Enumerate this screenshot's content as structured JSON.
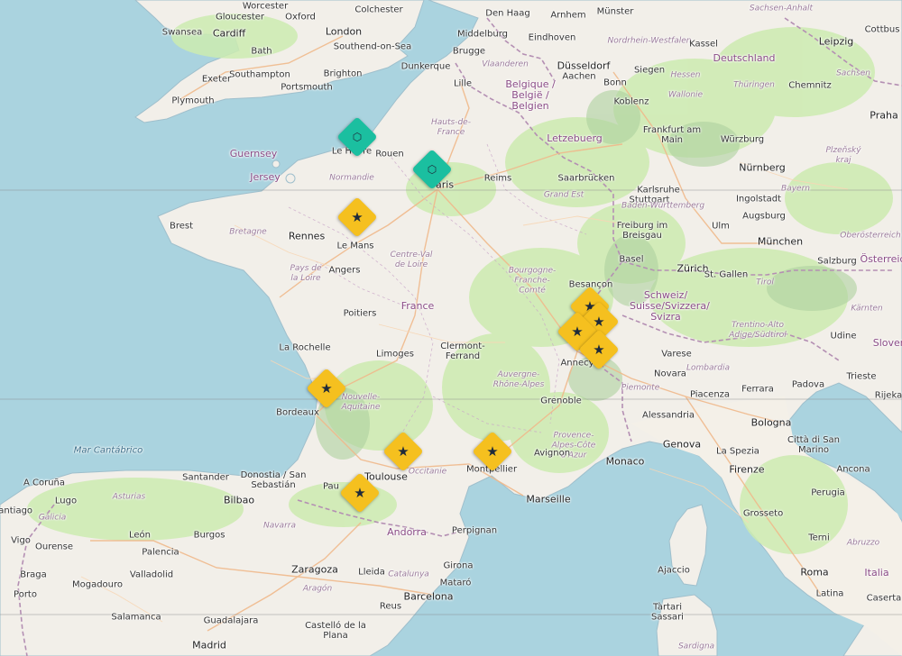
{
  "map": {
    "colors": {
      "water": "#aad3df",
      "land": "#f2efe9",
      "park": "#cdebb0",
      "forest": "#add19e",
      "border": "#b48fb3",
      "road": "#f0b98b",
      "star_marker": "#f5c01f",
      "site_marker": "#1bbfa0",
      "glyph": "#1e2a3a"
    },
    "labels": [
      {
        "text": "Worcester",
        "kind": "city"
      },
      {
        "text": "Colchester",
        "kind": "city"
      },
      {
        "text": "Den Haag",
        "kind": "city"
      },
      {
        "text": "Arnhem",
        "kind": "city"
      },
      {
        "text": "Münster",
        "kind": "city"
      },
      {
        "text": "Sachsen-Anhalt",
        "kind": "region"
      },
      {
        "text": "Gloucester",
        "kind": "city"
      },
      {
        "text": "Oxford",
        "kind": "city"
      },
      {
        "text": "Cottbus",
        "kind": "city"
      },
      {
        "text": "Swansea",
        "kind": "city"
      },
      {
        "text": "Cardiff",
        "kind": "capital"
      },
      {
        "text": "London",
        "kind": "capital"
      },
      {
        "text": "Middelburg",
        "kind": "city"
      },
      {
        "text": "Eindhoven",
        "kind": "city"
      },
      {
        "text": "Nordrhein-Westfalen",
        "kind": "region"
      },
      {
        "text": "Kassel",
        "kind": "city"
      },
      {
        "text": "Leipzig",
        "kind": "city"
      },
      {
        "text": "Bath",
        "kind": "city"
      },
      {
        "text": "Southend-on-Sea",
        "kind": "city"
      },
      {
        "text": "Brugge",
        "kind": "city"
      },
      {
        "text": "Vlaanderen",
        "kind": "region"
      },
      {
        "text": "Düsseldorf",
        "kind": "city"
      },
      {
        "text": "Hessen",
        "kind": "region"
      },
      {
        "text": "Deutschland",
        "kind": "country"
      },
      {
        "text": "Southampton",
        "kind": "city"
      },
      {
        "text": "Brighton",
        "kind": "city"
      },
      {
        "text": "Dunkerque",
        "kind": "city"
      },
      {
        "text": "Aachen",
        "kind": "city"
      },
      {
        "text": "Bonn",
        "kind": "city"
      },
      {
        "text": "Siegen",
        "kind": "city"
      },
      {
        "text": "Thüringen",
        "kind": "region"
      },
      {
        "text": "Exeter",
        "kind": "city"
      },
      {
        "text": "Portsmouth",
        "kind": "city"
      },
      {
        "text": "Lille",
        "kind": "city"
      },
      {
        "text": "Sachsen",
        "kind": "region"
      },
      {
        "text": "Belgique / België / Belgien",
        "kind": "country"
      },
      {
        "text": "Wallonie",
        "kind": "region"
      },
      {
        "text": "Koblenz",
        "kind": "city"
      },
      {
        "text": "Chemnitz",
        "kind": "city"
      },
      {
        "text": "Plymouth",
        "kind": "city"
      },
      {
        "text": "Hauts-de-France",
        "kind": "region"
      },
      {
        "text": "Letzebuerg",
        "kind": "country"
      },
      {
        "text": "Frankfurt am Main",
        "kind": "city"
      },
      {
        "text": "Würzburg",
        "kind": "city"
      },
      {
        "text": "Praha",
        "kind": "city"
      },
      {
        "text": "Guernsey",
        "kind": "country"
      },
      {
        "text": "Le Havre",
        "kind": "city"
      },
      {
        "text": "Rouen",
        "kind": "city"
      },
      {
        "text": "Saarbrücken",
        "kind": "city"
      },
      {
        "text": "Plzeňský kraj",
        "kind": "region"
      },
      {
        "text": "Jersey",
        "kind": "country"
      },
      {
        "text": "Normandie",
        "kind": "region"
      },
      {
        "text": "Reims",
        "kind": "city"
      },
      {
        "text": "Nürnberg",
        "kind": "city"
      },
      {
        "text": "Grand Est",
        "kind": "region"
      },
      {
        "text": "Karlsruhe",
        "kind": "city"
      },
      {
        "text": "Paris",
        "kind": "capital"
      },
      {
        "text": "Bayern",
        "kind": "region"
      },
      {
        "text": "Ingolstadt",
        "kind": "city"
      },
      {
        "text": "Stuttgart",
        "kind": "city"
      },
      {
        "text": "Baden-Württemberg",
        "kind": "region"
      },
      {
        "text": "Brest",
        "kind": "city"
      },
      {
        "text": "Augsburg",
        "kind": "city"
      },
      {
        "text": "Bretagne",
        "kind": "region"
      },
      {
        "text": "Rennes",
        "kind": "city"
      },
      {
        "text": "Le Mans",
        "kind": "city"
      },
      {
        "text": "Ulm",
        "kind": "city"
      },
      {
        "text": "Freiburg im Breisgau",
        "kind": "city"
      },
      {
        "text": "München",
        "kind": "city"
      },
      {
        "text": "Oberösterreich",
        "kind": "region"
      },
      {
        "text": "Centre-Val de Loire",
        "kind": "region"
      },
      {
        "text": "Angers",
        "kind": "city"
      },
      {
        "text": "Basel",
        "kind": "city"
      },
      {
        "text": "Zürich",
        "kind": "city"
      },
      {
        "text": "Salzburg",
        "kind": "city"
      },
      {
        "text": "Österreich",
        "kind": "country"
      },
      {
        "text": "Pays de la Loire",
        "kind": "region"
      },
      {
        "text": "Bourgogne-Franche-Comté",
        "kind": "region"
      },
      {
        "text": "St. Gallen",
        "kind": "city"
      },
      {
        "text": "Tirol",
        "kind": "region"
      },
      {
        "text": "Besançon",
        "kind": "city"
      },
      {
        "text": "France",
        "kind": "country"
      },
      {
        "text": "Schweiz/ Suisse/Svizzera/ Svizra",
        "kind": "country"
      },
      {
        "text": "Poitiers",
        "kind": "city"
      },
      {
        "text": "Kärnten",
        "kind": "region"
      },
      {
        "text": "Trentino-Alto Adige/Südtirol",
        "kind": "region"
      },
      {
        "text": "La Rochelle",
        "kind": "city"
      },
      {
        "text": "Clermont-Ferrand",
        "kind": "city"
      },
      {
        "text": "Udine",
        "kind": "city"
      },
      {
        "text": "Limoges",
        "kind": "city"
      },
      {
        "text": "Slover",
        "kind": "country"
      },
      {
        "text": "Varese",
        "kind": "city"
      },
      {
        "text": "Annecy",
        "kind": "city"
      },
      {
        "text": "Novara",
        "kind": "city"
      },
      {
        "text": "Lombardia",
        "kind": "region"
      },
      {
        "text": "Padova",
        "kind": "city"
      },
      {
        "text": "Trieste",
        "kind": "city"
      },
      {
        "text": "Auvergne-Rhône-Alpes",
        "kind": "region"
      },
      {
        "text": "Nouvelle-Aquitaine",
        "kind": "region"
      },
      {
        "text": "Piemonte",
        "kind": "region"
      },
      {
        "text": "Piacenza",
        "kind": "city"
      },
      {
        "text": "Ferrara",
        "kind": "city"
      },
      {
        "text": "Rijeka",
        "kind": "city"
      },
      {
        "text": "Bordeaux",
        "kind": "city"
      },
      {
        "text": "Grenoble",
        "kind": "city"
      },
      {
        "text": "Alessandria",
        "kind": "city"
      },
      {
        "text": "Bologna",
        "kind": "city"
      },
      {
        "text": "Genova",
        "kind": "city"
      },
      {
        "text": "Provence-Alpes-Côte d'Azur",
        "kind": "region"
      },
      {
        "text": "Avignon",
        "kind": "city"
      },
      {
        "text": "Città di San Marino",
        "kind": "city"
      },
      {
        "text": "La Spezia",
        "kind": "city"
      },
      {
        "text": "Santander",
        "kind": "city"
      },
      {
        "text": "Toulouse",
        "kind": "city"
      },
      {
        "text": "Occitanie",
        "kind": "region"
      },
      {
        "text": "Montpellier",
        "kind": "city"
      },
      {
        "text": "Monaco",
        "kind": "city"
      },
      {
        "text": "Ancona",
        "kind": "city"
      },
      {
        "text": "A Coruña",
        "kind": "city"
      },
      {
        "text": "Donostia / San Sebastián",
        "kind": "city"
      },
      {
        "text": "Firenze",
        "kind": "city"
      },
      {
        "text": "Perugia",
        "kind": "city"
      },
      {
        "text": "Pau",
        "kind": "city"
      },
      {
        "text": "Lugo",
        "kind": "city"
      },
      {
        "text": "Asturias",
        "kind": "region"
      },
      {
        "text": "Bilbao",
        "kind": "city"
      },
      {
        "text": "Marseille",
        "kind": "city"
      },
      {
        "text": "Santiago",
        "kind": "city"
      },
      {
        "text": "Galicia",
        "kind": "region"
      },
      {
        "text": "Grosseto",
        "kind": "city"
      },
      {
        "text": "Vigo",
        "kind": "city"
      },
      {
        "text": "León",
        "kind": "city"
      },
      {
        "text": "Burgos",
        "kind": "city"
      },
      {
        "text": "Navarra",
        "kind": "region"
      },
      {
        "text": "Andorra",
        "kind": "country"
      },
      {
        "text": "Perpignan",
        "kind": "city"
      },
      {
        "text": "Ourense",
        "kind": "city"
      },
      {
        "text": "Palencia",
        "kind": "city"
      },
      {
        "text": "Terni",
        "kind": "city"
      },
      {
        "text": "Abruzzo",
        "kind": "region"
      },
      {
        "text": "Braga",
        "kind": "city"
      },
      {
        "text": "Valladolid",
        "kind": "city"
      },
      {
        "text": "Zaragoza",
        "kind": "city"
      },
      {
        "text": "Lleida",
        "kind": "city"
      },
      {
        "text": "Catalunya",
        "kind": "region"
      },
      {
        "text": "Girona",
        "kind": "city"
      },
      {
        "text": "Ajaccio",
        "kind": "city"
      },
      {
        "text": "Roma",
        "kind": "capital"
      },
      {
        "text": "Italia",
        "kind": "country"
      },
      {
        "text": "Porto",
        "kind": "city"
      },
      {
        "text": "Mogadouro",
        "kind": "city"
      },
      {
        "text": "Aragón",
        "kind": "region"
      },
      {
        "text": "Mataró",
        "kind": "city"
      },
      {
        "text": "Barcelona",
        "kind": "city"
      },
      {
        "text": "Latina",
        "kind": "city"
      },
      {
        "text": "Caserta",
        "kind": "city"
      },
      {
        "text": "Salamanca",
        "kind": "city"
      },
      {
        "text": "Guadalajara",
        "kind": "city"
      },
      {
        "text": "Reus",
        "kind": "city"
      },
      {
        "text": "Castelló de la Plana",
        "kind": "city"
      },
      {
        "text": "Tàrtari",
        "kind": "city"
      },
      {
        "text": "Sassari",
        "kind": "city"
      },
      {
        "text": "Madrid",
        "kind": "capital"
      },
      {
        "text": "Sardigna",
        "kind": "region"
      },
      {
        "text": "Mar Cantábrico",
        "kind": "sea"
      }
    ],
    "markers": [
      {
        "type": "site",
        "icon": "hexagon-icon",
        "glyph": "⬡",
        "place": "Le Havre"
      },
      {
        "type": "site",
        "icon": "hexagon-icon",
        "glyph": "⬡",
        "place": "Paris"
      },
      {
        "type": "star",
        "icon": "star-icon",
        "glyph": "★",
        "place": "Le Mans"
      },
      {
        "type": "star",
        "icon": "star-icon",
        "glyph": "★",
        "place": "Besançon"
      },
      {
        "type": "star",
        "icon": "star-icon",
        "glyph": "★",
        "place": "Geneva"
      },
      {
        "type": "star",
        "icon": "star-icon",
        "glyph": "★",
        "place": "Lausanne"
      },
      {
        "type": "star",
        "icon": "star-icon",
        "glyph": "★",
        "place": "Chamonix"
      },
      {
        "type": "star",
        "icon": "star-icon",
        "glyph": "★",
        "place": "Bordeaux"
      },
      {
        "type": "star",
        "icon": "star-icon",
        "glyph": "★",
        "place": "Toulouse"
      },
      {
        "type": "star",
        "icon": "star-icon",
        "glyph": "★",
        "place": "Montpellier"
      },
      {
        "type": "star",
        "icon": "star-icon",
        "glyph": "★",
        "place": "Pau"
      }
    ]
  }
}
